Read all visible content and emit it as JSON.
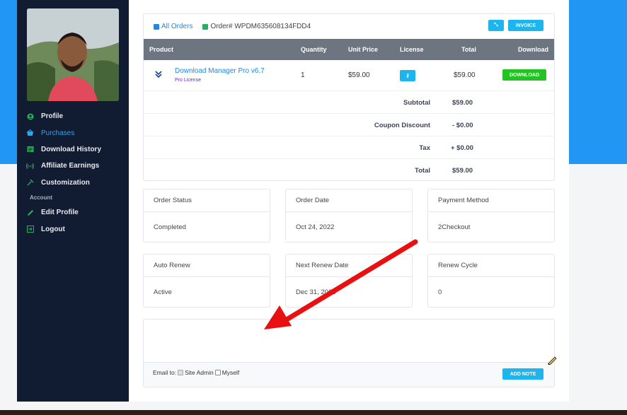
{
  "sidebar": {
    "items": [
      {
        "label": "Profile",
        "icon": "user-circle-icon"
      },
      {
        "label": "Purchases",
        "icon": "basket-icon"
      },
      {
        "label": "Download History",
        "icon": "list-icon"
      },
      {
        "label": "Affiliate Earnings",
        "icon": "signal-icon"
      },
      {
        "label": "Customization",
        "icon": "hammer-icon"
      }
    ],
    "section": "Account",
    "account_items": [
      {
        "label": "Edit Profile",
        "icon": "pencil-icon"
      },
      {
        "label": "Logout",
        "icon": "logout-icon"
      }
    ]
  },
  "order": {
    "all_orders_label": "All Orders",
    "order_no": "Order# WPDM635608134FDD4",
    "invoice_label": "INVOICE",
    "columns": [
      "Product",
      "Quantity",
      "Unit Price",
      "License",
      "Total",
      "Download"
    ],
    "product_name": "Download Manager Pro v6.7",
    "product_license": "Pro License",
    "quantity": "1",
    "unit_price": "$59.00",
    "total": "$59.00",
    "download_label": "DOWNLOAD",
    "summary": [
      {
        "label": "Subtotal",
        "value": "$59.00"
      },
      {
        "label": "Coupon Discount",
        "value": "- $0.00"
      },
      {
        "label": "Tax",
        "value": "+ $0.00"
      },
      {
        "label": "Total",
        "value": "$59.00"
      }
    ]
  },
  "info": {
    "order_status": {
      "label": "Order Status",
      "value": "Completed"
    },
    "order_date": {
      "label": "Order Date",
      "value": "Oct 24, 2022"
    },
    "payment_method": {
      "label": "Payment Method",
      "value": "2Checkout"
    },
    "auto_renew": {
      "label": "Auto Renew",
      "value": "Active"
    },
    "next_renew": {
      "label": "Next Renew Date",
      "value": "Dec 31, 2023"
    },
    "renew_cycle": {
      "label": "Renew Cycle",
      "value": "0"
    }
  },
  "note": {
    "email_to": "Email to:",
    "site_admin": "Site Admin",
    "myself": "Myself",
    "add_note": "ADD NOTE"
  },
  "colors": {
    "accent": "#1cb5ee",
    "sidebar_bg": "#111c32",
    "download_green": "#22c322",
    "arrow_red": "#e81010"
  }
}
